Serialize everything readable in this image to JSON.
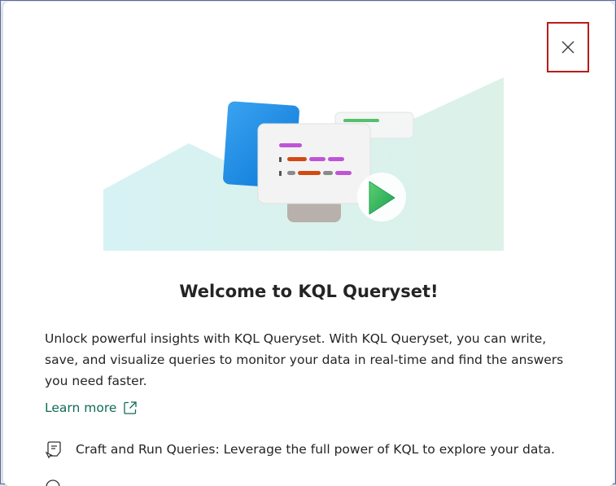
{
  "dialog": {
    "title": "Welcome to KQL Queryset!",
    "description": "Unlock powerful insights with KQL Queryset. With KQL Queryset, you can write, save, and visualize queries to monitor your data in real-time and find the answers you need faster.",
    "learn_more_label": "Learn more",
    "close_icon": "close-icon",
    "features": [
      {
        "icon": "query-document-icon",
        "text": "Craft and Run Queries: Leverage the full power of KQL to explore your data."
      }
    ]
  },
  "colors": {
    "accent_link": "#116b55",
    "close_highlight": "#b71c1c",
    "text_primary": "#242424",
    "hero_background": "#dff3ef"
  }
}
